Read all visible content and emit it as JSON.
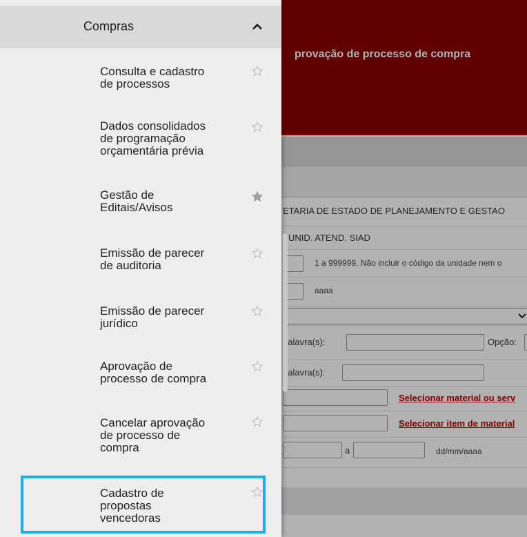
{
  "background": {
    "header_title": "provação de processo de compra",
    "org_text": "ETARIA DE ESTADO DE PLANEJAMENTO E GESTAO",
    "unit_text": "- UNID. ATEND. SIAD",
    "range_hint": "1 a 999999. Não incluir o código da unidade nem o",
    "year_hint": "aaaa",
    "keyword_label_1": "palavra(s):",
    "option_label": "Opção:",
    "keyword_label_2": "palavra(s):",
    "select_material_link": "Selecionar material ou serv",
    "select_item_link": "Selecionar item de material",
    "date_range_sep": "a",
    "date_hint": "dd/mm/aaaa"
  },
  "drawer": {
    "section_title": "Compras",
    "items": [
      {
        "label": "Consulta e cadastro\nde processos",
        "favorite": false
      },
      {
        "label": "Dados consolidados\nde programação\norçamentária prévia",
        "favorite": false
      },
      {
        "label": "Gestão de\nEditais/Avisos",
        "favorite": true
      },
      {
        "label": "Emissão de parecer\nde auditoria",
        "favorite": false
      },
      {
        "label": "Emissão de parecer\njurídico",
        "favorite": false
      },
      {
        "label": "Aprovação de\nprocesso de compra",
        "favorite": false
      },
      {
        "label": "Cancelar aprovação\nde processo de\ncompra",
        "favorite": false
      },
      {
        "label": "Cadastro de\npropostas\nvencedoras",
        "favorite": false
      }
    ]
  },
  "colors": {
    "header_red": "#8a0000",
    "link_red": "#b00000",
    "highlight_blue": "#12b0f0",
    "star_outline": "#b8b8b8",
    "star_filled": "#a0a0a0"
  }
}
